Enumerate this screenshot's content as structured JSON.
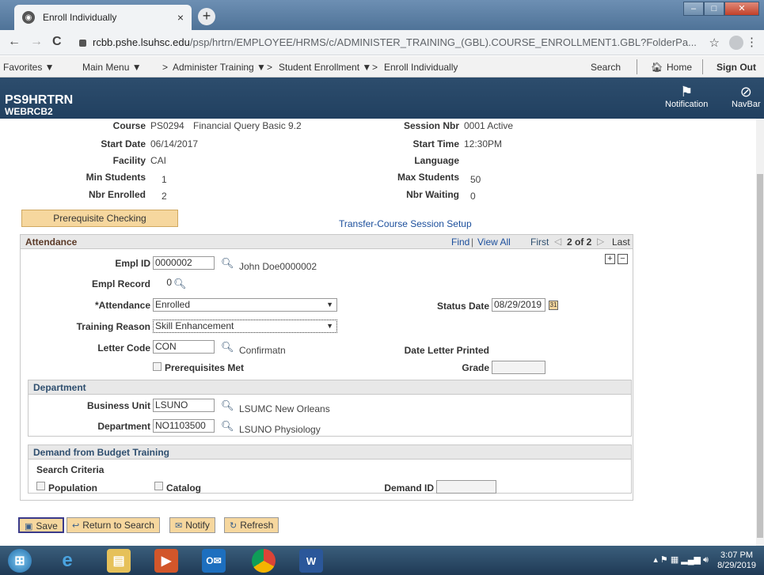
{
  "browser": {
    "tab_title": "Enroll Individually",
    "tab_close": "×",
    "new_tab": "+",
    "url_host": "rcbb.pshe.lsuhsc.edu",
    "url_path": "/psp/hrtrn/EMPLOYEE/HRMS/c/ADMINISTER_TRAINING_(GBL).COURSE_ENROLLMENT1.GBL?FolderPa...",
    "back": "←",
    "forward": "→",
    "reload": "C",
    "star": "☆",
    "menu": "⋮"
  },
  "psnav": {
    "favorites": "Favorites ▼",
    "main_menu": "Main Menu ▼",
    "crumb1": "Administer Training ▼",
    "crumb2": "Student Enrollment ▼",
    "crumb3": "Enroll Individually",
    "search": "Search",
    "home": "Home",
    "sign_out": "Sign Out"
  },
  "header": {
    "line1": "PS9HRTRN",
    "line2": "WEBRCB2",
    "notification": "Notification",
    "navbar": "NavBar"
  },
  "course": {
    "course_label": "Course",
    "course_value": "PS0294",
    "course_desc": "Financial Query Basic 9.2",
    "session_label": "Session Nbr",
    "session_value": "0001 Active",
    "start_date_label": "Start Date",
    "start_date_value": "06/14/2017",
    "start_time_label": "Start Time",
    "start_time_value": "12:30PM",
    "facility_label": "Facility",
    "facility_value": "CAI",
    "language_label": "Language",
    "min_students_label": "Min Students",
    "min_students_value": "1",
    "max_students_label": "Max Students",
    "max_students_value": "50",
    "nbr_enrolled_label": "Nbr Enrolled",
    "nbr_enrolled_value": "2",
    "nbr_waiting_label": "Nbr Waiting",
    "nbr_waiting_value": "0",
    "prereq_button": "Prerequisite Checking",
    "transfer_link": "Transfer-Course Session Setup"
  },
  "attendance": {
    "title": "Attendance",
    "find": "Find",
    "view_all": "View All",
    "first": "First",
    "pager": "2 of 2",
    "last": "Last",
    "empl_id_label": "Empl ID",
    "empl_id_value": "0000002",
    "empl_name": "John Doe0000002",
    "empl_record_label": "Empl Record",
    "empl_record_value": "0",
    "attendance_label": "*Attendance",
    "attendance_value": "Enrolled",
    "status_date_label": "Status Date",
    "status_date_value": "08/29/2019",
    "training_reason_label": "Training Reason",
    "training_reason_value": "Skill Enhancement",
    "letter_code_label": "Letter Code",
    "letter_code_value": "CON",
    "letter_code_desc": "Confirmatn",
    "date_letter_printed_label": "Date Letter Printed",
    "prereq_met_label": "Prerequisites Met",
    "grade_label": "Grade"
  },
  "department": {
    "title": "Department",
    "business_unit_label": "Business Unit",
    "business_unit_value": "LSUNO",
    "business_unit_desc": "LSUMC New Orleans",
    "department_label": "Department",
    "department_value": "NO1103500",
    "department_desc": "LSUNO Physiology"
  },
  "demand": {
    "title": "Demand from Budget Training",
    "search_criteria": "Search Criteria",
    "population_label": "Population",
    "catalog_label": "Catalog",
    "demand_id_label": "Demand ID"
  },
  "footer": {
    "save": "Save",
    "return_to_search": "Return to Search",
    "notify": "Notify",
    "refresh": "Refresh"
  },
  "taskbar": {
    "time": "3:07 PM",
    "date": "8/29/2019"
  }
}
